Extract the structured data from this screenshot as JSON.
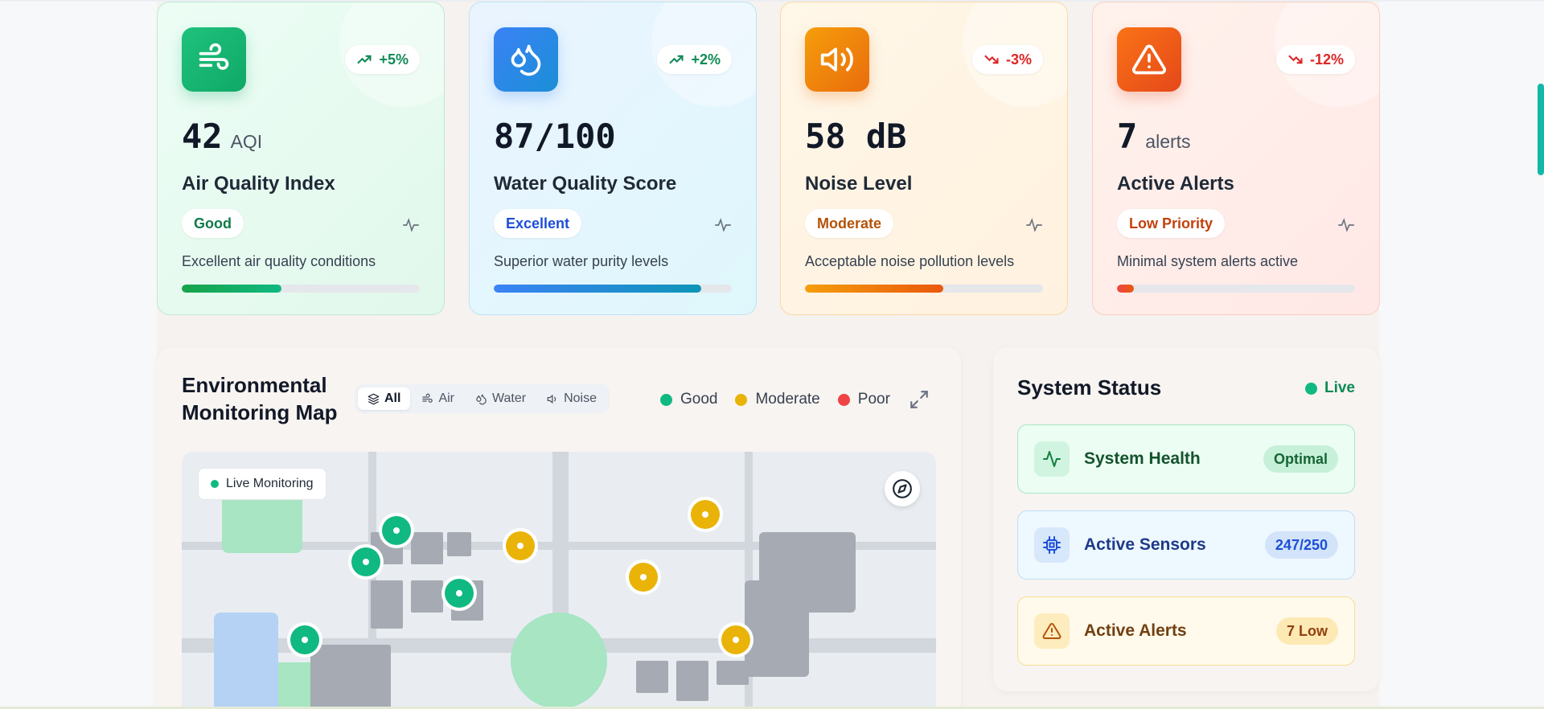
{
  "metrics": [
    {
      "key": "air",
      "icon": "wind-icon",
      "trend": "+5%",
      "trend_dir": "up",
      "value": "42",
      "unit": "AQI",
      "title": "Air Quality Index",
      "badge": "Good",
      "description": "Excellent air quality conditions",
      "progress": 0.42,
      "accent": "#10a866"
    },
    {
      "key": "water",
      "icon": "droplets-icon",
      "trend": "+2%",
      "trend_dir": "up",
      "value": "87/100",
      "unit": "",
      "title": "Water Quality Score",
      "badge": "Excellent",
      "description": "Superior water purity levels",
      "progress": 0.87,
      "accent": "#3b82f6"
    },
    {
      "key": "noise",
      "icon": "speaker-icon",
      "trend": "-3%",
      "trend_dir": "down",
      "value": "58 dB",
      "unit": "",
      "title": "Noise Level",
      "badge": "Moderate",
      "description": "Acceptable noise pollution levels",
      "progress": 0.58,
      "accent": "#ea6c0c"
    },
    {
      "key": "alerts",
      "icon": "warning-icon",
      "trend": "-12%",
      "trend_dir": "down",
      "value": "7",
      "unit": "alerts",
      "title": "Active Alerts",
      "badge": "Low Priority",
      "description": "Minimal system alerts active",
      "progress": 0.07,
      "accent": "#e5481a"
    }
  ],
  "map": {
    "title": "Environmental Monitoring Map",
    "filters": [
      "All",
      "Air",
      "Water",
      "Noise"
    ],
    "active_filter": "All",
    "legend": [
      {
        "label": "Good",
        "color": "#10b981"
      },
      {
        "label": "Moderate",
        "color": "#eab308"
      },
      {
        "label": "Poor",
        "color": "#ef4444"
      }
    ],
    "live_label": "Live Monitoring",
    "sensor_status": [
      "good",
      "good",
      "good",
      "good",
      "moderate",
      "moderate",
      "moderate",
      "moderate"
    ]
  },
  "status": {
    "title": "System Status",
    "live_label": "Live",
    "rows": [
      {
        "key": "health",
        "icon": "activity-icon",
        "label": "System Health",
        "value": "Optimal"
      },
      {
        "key": "sensors",
        "icon": "cpu-icon",
        "label": "Active Sensors",
        "value": "247/250"
      },
      {
        "key": "alerts",
        "icon": "warning-icon",
        "label": "Active Alerts",
        "value": "7 Low"
      }
    ]
  },
  "colors": {
    "good": "#10b981",
    "moderate": "#eab308",
    "poor": "#ef4444",
    "live": "#10b981"
  }
}
